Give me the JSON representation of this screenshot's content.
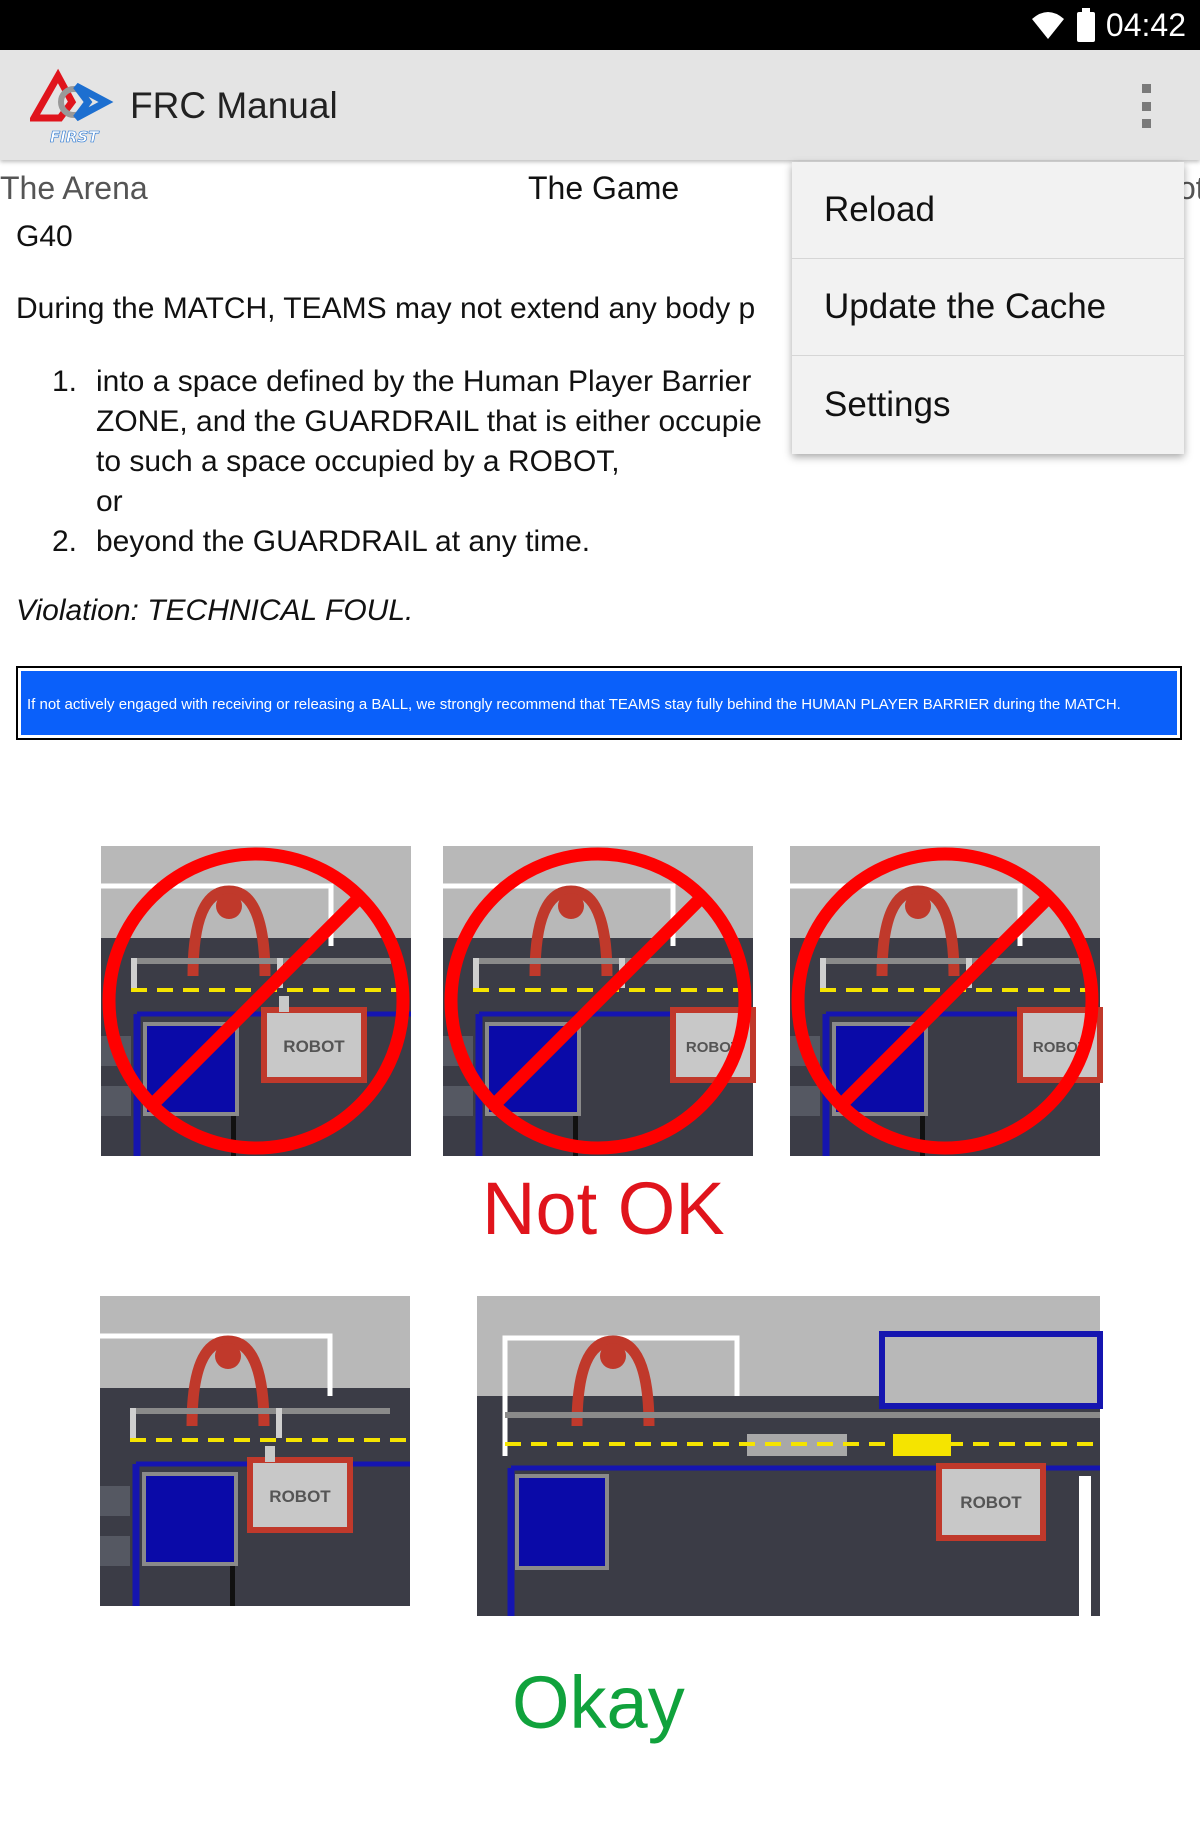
{
  "status_bar": {
    "time": "04:42"
  },
  "app_bar": {
    "title": "FRC Manual",
    "logo_text": "FIRST"
  },
  "tabs": [
    {
      "label": "The Arena"
    },
    {
      "label": "The Game"
    },
    {
      "label": "ot"
    }
  ],
  "rule": {
    "id": "G40",
    "intro": "During the MATCH, TEAMS may not extend any body p",
    "items": [
      {
        "num": "1.",
        "lines": [
          "into a space defined by the Human Player Barrier",
          "ZONE, and the GUARDRAIL that is either occupie",
          "to such a space occupied by a ROBOT,",
          "or"
        ]
      },
      {
        "num": "2.",
        "lines": [
          "beyond the GUARDRAIL at any time."
        ]
      }
    ],
    "violation": "Violation: TECHNICAL FOUL.",
    "blue_note": "If not actively engaged with receiving or releasing a BALL, we strongly recommend that TEAMS stay fully behind the HUMAN PLAYER BARRIER during the MATCH."
  },
  "figure": {
    "robot_label": "ROBOT",
    "not_ok_label": "Not OK",
    "okay_label": "Okay"
  },
  "overflow_menu": [
    {
      "label": "Reload"
    },
    {
      "label": "Update the Cache"
    },
    {
      "label": "Settings"
    }
  ]
}
